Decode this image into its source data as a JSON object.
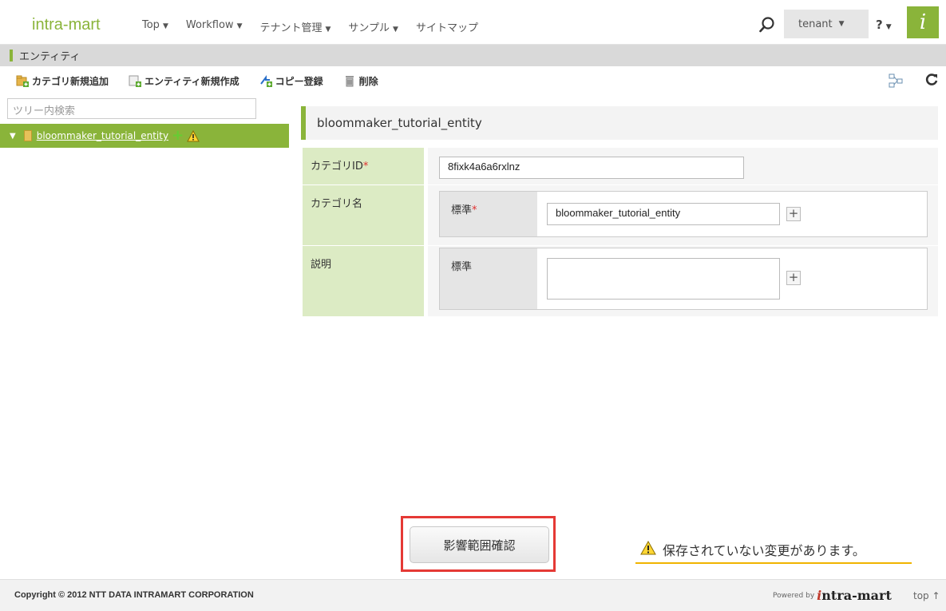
{
  "header": {
    "brand": "intra-mart",
    "nav": [
      {
        "label": "Top"
      },
      {
        "label": "Workflow"
      },
      {
        "label": "テナント管理"
      },
      {
        "label": "サンプル"
      },
      {
        "label": "サイトマップ"
      }
    ],
    "user": "tenant",
    "help": "?"
  },
  "page_title": "エンティティ",
  "toolbar": {
    "add_category": "カテゴリ新規追加",
    "new_entity": "エンティティ新規作成",
    "copy_register": "コピー登録",
    "delete": "削除"
  },
  "tree": {
    "search_placeholder": "ツリー内検索",
    "node_label": "bloommaker_tutorial_entity"
  },
  "section_title": "bloommaker_tutorial_entity",
  "form": {
    "category_id_label": "カテゴリID",
    "category_id_value": "8fixk4a6a6rxlnz",
    "category_name_label": "カテゴリ名",
    "category_name_sub_label": "標準",
    "category_name_value": "bloommaker_tutorial_entity",
    "description_label": "説明",
    "description_sub_label": "標準",
    "description_value": "",
    "required_mark": "*",
    "plus": "+"
  },
  "impact_button": "影響範囲確認",
  "unsaved_message": "保存されていない変更があります。",
  "footer": {
    "copyright": "Copyright © 2012 NTT DATA INTRAMART CORPORATION",
    "powered_by": "Powered by",
    "logo_i": "i",
    "logo_rest": "ntra-mart",
    "top_link": "top ↑"
  },
  "colors": {
    "accent": "#8ab43a",
    "label_bg": "#dcebc4",
    "highlight": "#e53935",
    "warning": "#f0b400"
  }
}
